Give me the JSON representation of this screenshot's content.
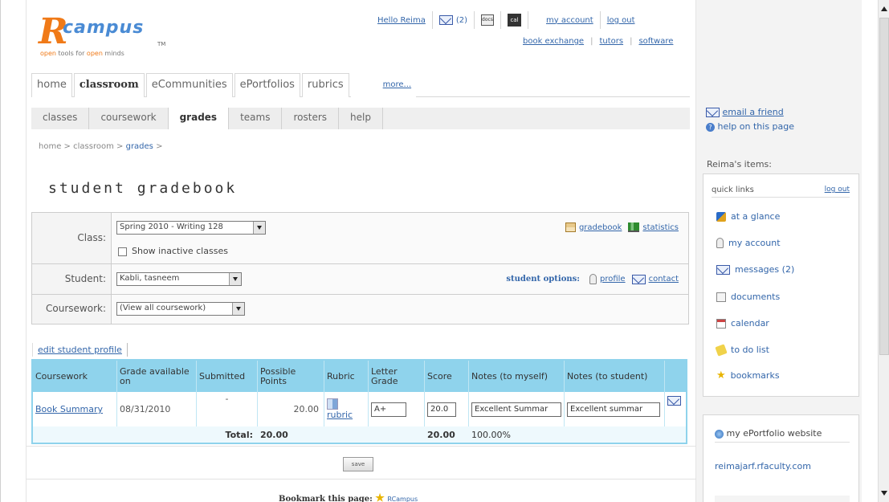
{
  "logo": {
    "brand": "campus",
    "initial": "R",
    "tm": "TM",
    "tagline_open1": "open",
    "tagline_mid": " tools for ",
    "tagline_open2": "open",
    "tagline_end": " minds"
  },
  "toplinks": {
    "hello": "Hello Reima",
    "messages_count": "(2)",
    "doc_label": "docs",
    "cal_label": "cal",
    "my_account": "my account",
    "log_out": "log out"
  },
  "sublinks": [
    "book exchange",
    "tutors",
    "software"
  ],
  "main_tabs": [
    "home",
    "classroom",
    "eCommunities",
    "ePortfolios",
    "rubrics"
  ],
  "main_more": "more...",
  "sub_tabs": [
    "classes",
    "coursework",
    "grades",
    "teams",
    "rosters",
    "help"
  ],
  "breadcrumb": {
    "home": "home",
    "sep": ">",
    "classroom": "classroom",
    "grades": "grades"
  },
  "page_title": "student gradebook",
  "form": {
    "class_label": "Class:",
    "class_value": "Spring 2010 - Writing 128",
    "show_inactive": "Show inactive classes",
    "gradebook_link": "gradebook",
    "statistics_link": "statistics",
    "student_label": "Student:",
    "student_value": "Kabli, tasneem",
    "student_options": "student options:",
    "profile_link": "profile",
    "contact_link": "contact",
    "coursework_label": "Coursework:",
    "coursework_value": "(View all coursework)"
  },
  "edit_profile": "edit student profile",
  "gradebook": {
    "headers": [
      "Coursework",
      "Grade available on",
      "Submitted",
      "Possible Points",
      "Rubric",
      "Letter Grade",
      "Score",
      "Notes (to myself)",
      "Notes (to student)"
    ],
    "rows": [
      {
        "coursework": "Book Summary",
        "available": "08/31/2010",
        "submitted": "-",
        "possible": "20.00",
        "rubric": "rubric",
        "letter": "A+",
        "score": "20.0",
        "notes_self": "Excellent Summar",
        "notes_student": "Excellent summar"
      }
    ],
    "total_label": "Total:",
    "total_possible": "20.00",
    "total_score": "20.00",
    "total_percent": "100.00%"
  },
  "save_label": "save",
  "bookmark": {
    "label": "Bookmark this page:",
    "link": "RCampus"
  },
  "sidebar": {
    "email_friend": "email a friend",
    "help_page": "help on this page",
    "items_label": "Reima's items:",
    "quick_links": "quick links",
    "log_out": "log out",
    "items": [
      "at a glance",
      "my account",
      "messages (2)",
      "documents",
      "calendar",
      "to do list",
      "bookmarks"
    ],
    "eportfolio_title": "my ePortfolio website",
    "eportfolio_url": "reimajarf.rfaculty.com"
  }
}
